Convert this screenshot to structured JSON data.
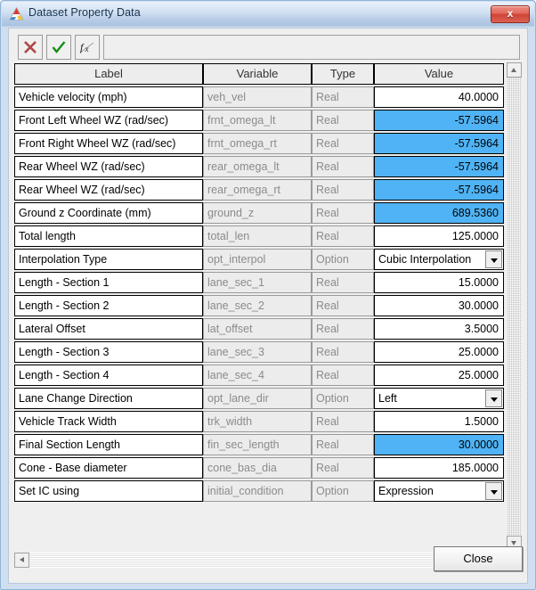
{
  "window": {
    "title": "Dataset Property Data",
    "icon": "app-triangle-icon",
    "close_label": "x",
    "frame_color": "#cfdff0",
    "titlebar_color": "#b6cce6"
  },
  "toolbar": {
    "cancel_label": "",
    "accept_label": "",
    "function_label": "",
    "cancel_icon": "red-x-icon",
    "accept_icon": "green-check-icon",
    "function_icon": "fx-function-icon",
    "expression_value": "",
    "expression_placeholder": ""
  },
  "grid": {
    "columns": [
      "Label",
      "Variable",
      "Type",
      "Value"
    ],
    "highlight_color": "#4fb3f5",
    "rows": [
      {
        "label": "Vehicle velocity (mph)",
        "variable": "veh_vel",
        "type": "Real",
        "value": "40.0000",
        "selected": false,
        "option": false
      },
      {
        "label": "Front Left Wheel WZ (rad/sec)",
        "variable": "frnt_omega_lt",
        "type": "Real",
        "value": "-57.5964",
        "selected": true,
        "option": false
      },
      {
        "label": "Front Right Wheel WZ (rad/sec)",
        "variable": "frnt_omega_rt",
        "type": "Real",
        "value": "-57.5964",
        "selected": true,
        "option": false
      },
      {
        "label": "Rear Wheel WZ (rad/sec)",
        "variable": "rear_omega_lt",
        "type": "Real",
        "value": "-57.5964",
        "selected": true,
        "option": false
      },
      {
        "label": "Rear Wheel WZ (rad/sec)",
        "variable": "rear_omega_rt",
        "type": "Real",
        "value": "-57.5964",
        "selected": true,
        "option": false
      },
      {
        "label": "Ground z Coordinate (mm)",
        "variable": "ground_z",
        "type": "Real",
        "value": "689.5360",
        "selected": true,
        "option": false
      },
      {
        "label": "Total length",
        "variable": "total_len",
        "type": "Real",
        "value": "125.0000",
        "selected": false,
        "option": false
      },
      {
        "label": "Interpolation Type",
        "variable": "opt_interpol",
        "type": "Option",
        "value": "Cubic Interpolation",
        "selected": false,
        "option": true
      },
      {
        "label": "Length - Section 1",
        "variable": "lane_sec_1",
        "type": "Real",
        "value": "15.0000",
        "selected": false,
        "option": false
      },
      {
        "label": "Length - Section 2",
        "variable": "lane_sec_2",
        "type": "Real",
        "value": "30.0000",
        "selected": false,
        "option": false
      },
      {
        "label": "Lateral Offset",
        "variable": "lat_offset",
        "type": "Real",
        "value": "3.5000",
        "selected": false,
        "option": false
      },
      {
        "label": "Length - Section 3",
        "variable": "lane_sec_3",
        "type": "Real",
        "value": "25.0000",
        "selected": false,
        "option": false
      },
      {
        "label": "Length - Section 4",
        "variable": "lane_sec_4",
        "type": "Real",
        "value": "25.0000",
        "selected": false,
        "option": false
      },
      {
        "label": "Lane Change Direction",
        "variable": "opt_lane_dir",
        "type": "Option",
        "value": "Left",
        "selected": false,
        "option": true
      },
      {
        "label": "Vehicle Track Width",
        "variable": "trk_width",
        "type": "Real",
        "value": "1.5000",
        "selected": false,
        "option": false
      },
      {
        "label": "Final Section Length",
        "variable": "fin_sec_length",
        "type": "Real",
        "value": "30.0000",
        "selected": true,
        "option": false
      },
      {
        "label": "Cone - Base diameter",
        "variable": "cone_bas_dia",
        "type": "Real",
        "value": "185.0000",
        "selected": false,
        "option": false
      },
      {
        "label": "Set IC using",
        "variable": "initial_condition",
        "type": "Option",
        "value": "Expression",
        "selected": false,
        "option": true
      }
    ]
  },
  "scrollbars": {
    "vertical_up_icon": "scroll-up-arrow-icon",
    "vertical_down_icon": "scroll-down-arrow-icon",
    "horizontal_left_icon": "scroll-left-arrow-icon",
    "horizontal_right_icon": "scroll-right-arrow-icon"
  },
  "footer": {
    "close_label": "Close"
  }
}
